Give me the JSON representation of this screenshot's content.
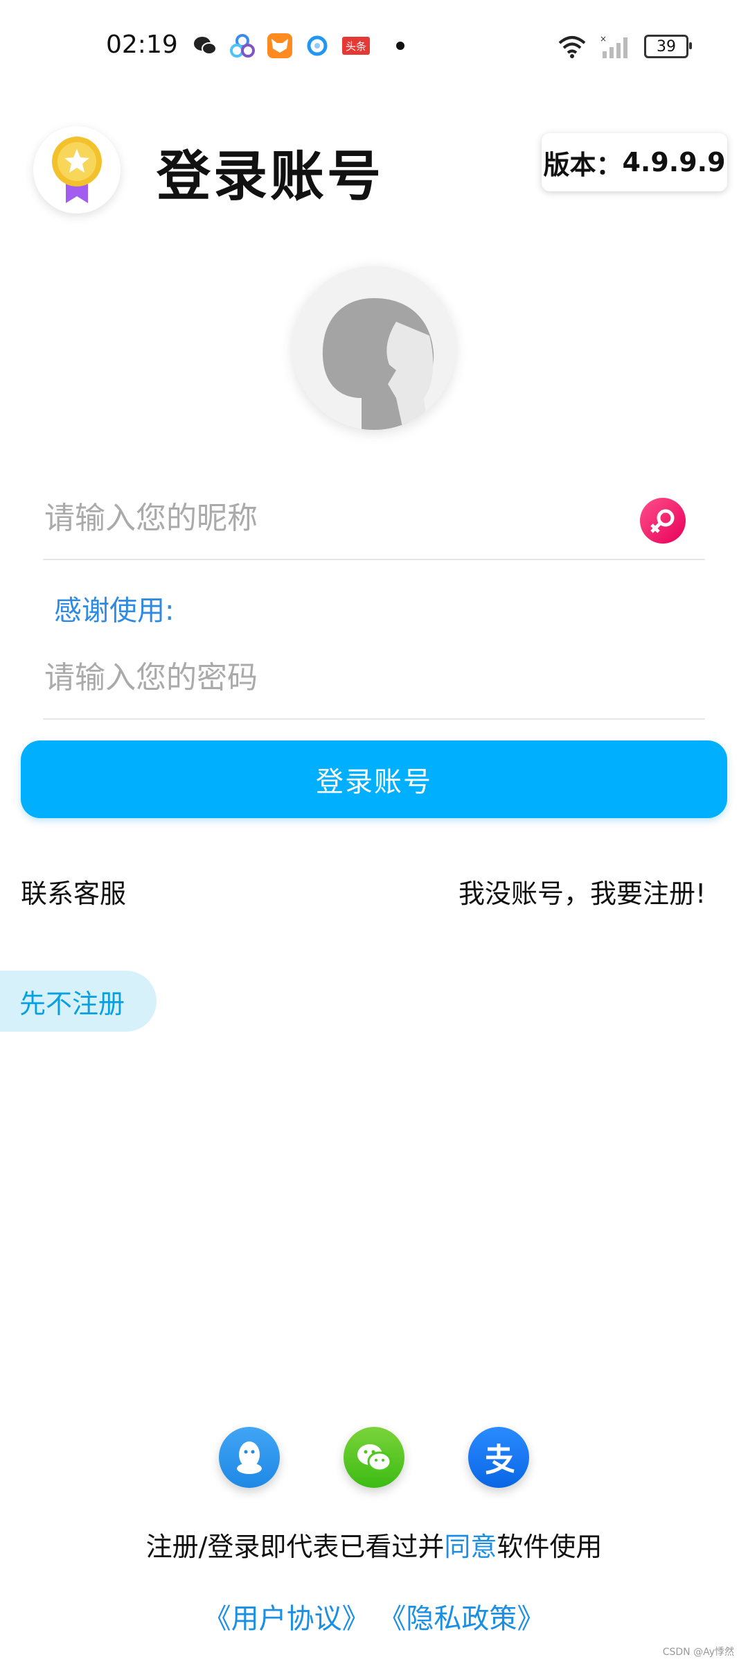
{
  "status_bar": {
    "time": "02:19",
    "battery": "39",
    "app_icons": [
      "wechat-icon",
      "baidu-netdisk-icon",
      "fox-app-icon",
      "browser-icon",
      "toutiao-icon"
    ],
    "toutiao_label": "头条"
  },
  "header": {
    "title": "登录账号",
    "version_label": "版本：",
    "version_value": "4.9.9.9"
  },
  "form": {
    "nickname_placeholder": "请输入您的昵称",
    "thanks_text": "感谢使用:",
    "password_placeholder": "请输入您的密码",
    "login_button": "登录账号"
  },
  "links": {
    "contact_support": "联系客服",
    "register": "我没账号，我要注册!",
    "skip_register": "先不注册"
  },
  "social_login": [
    "qq-icon",
    "wechat-icon",
    "alipay-icon"
  ],
  "footer": {
    "agreement_prefix": "注册/登录即代表已看过并",
    "agreement_highlight": "同意",
    "agreement_suffix": "软件使用",
    "user_agreement": "《用户协议》",
    "privacy_policy": "《隐私政策》",
    "watermark": "CSDN @Ay悸然"
  },
  "colors": {
    "primary": "#00b0ff",
    "link_blue": "#1a8fe3",
    "female_pink": "#f0186a",
    "qq_blue": "#2196f3",
    "wechat_green": "#4cc71a",
    "alipay_blue": "#1677ff"
  }
}
